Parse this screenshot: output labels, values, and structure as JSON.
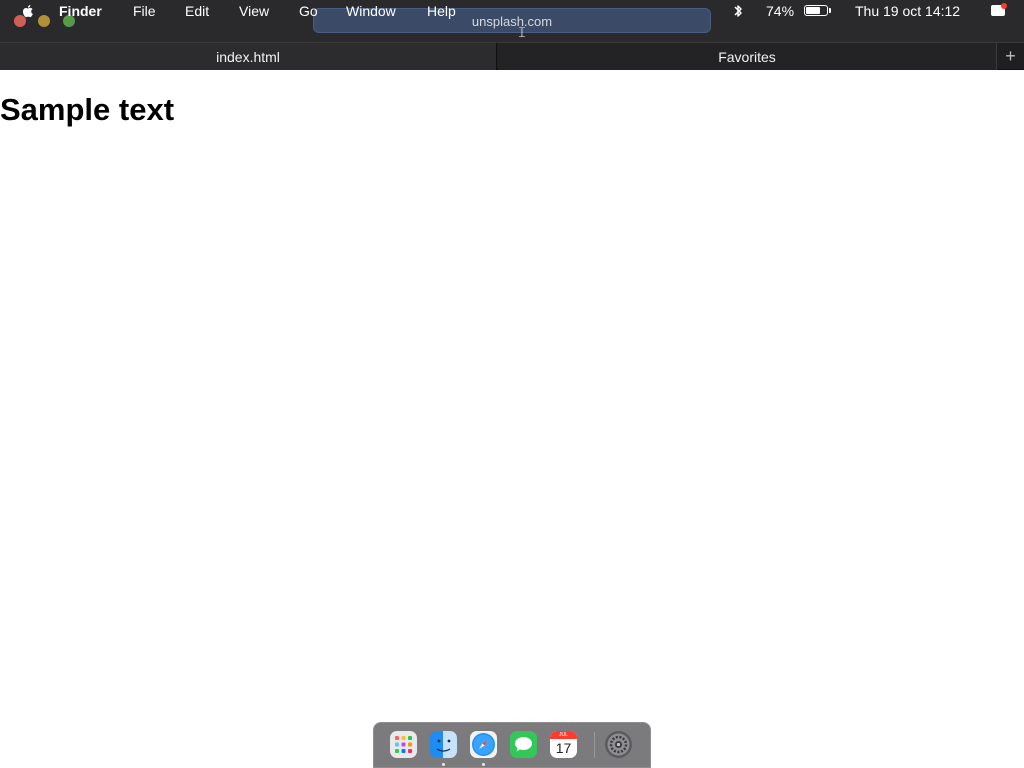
{
  "menubar": {
    "app_name": "Finder",
    "menus": [
      "File",
      "Edit",
      "View",
      "Go",
      "Window",
      "Help"
    ],
    "battery_percent": "74%",
    "battery_level": 0.74,
    "datetime": "Thu 19 oct 14:12"
  },
  "browser": {
    "address": "unsplash.com",
    "tabs": [
      {
        "label": "index.html",
        "active": true
      },
      {
        "label": "Favorites",
        "active": false
      }
    ],
    "new_tab_symbol": "+"
  },
  "page": {
    "heading": "Sample text"
  },
  "dock": {
    "items": [
      {
        "name": "launchpad-icon",
        "running": false
      },
      {
        "name": "finder-icon",
        "running": true
      },
      {
        "name": "safari-icon",
        "running": true
      },
      {
        "name": "messages-icon",
        "running": false
      },
      {
        "name": "calendar-icon",
        "running": false,
        "month": "JUL",
        "day": "17"
      },
      {
        "name": "system-settings-icon",
        "running": false
      }
    ]
  },
  "colors": {
    "menubar_bg": "#2a2a2c",
    "tabbar_bg": "#1f1f21",
    "address_bg": "#3b4a66",
    "dock_bg": "#7b7b7d",
    "notification_dot": "#ff3b30"
  }
}
